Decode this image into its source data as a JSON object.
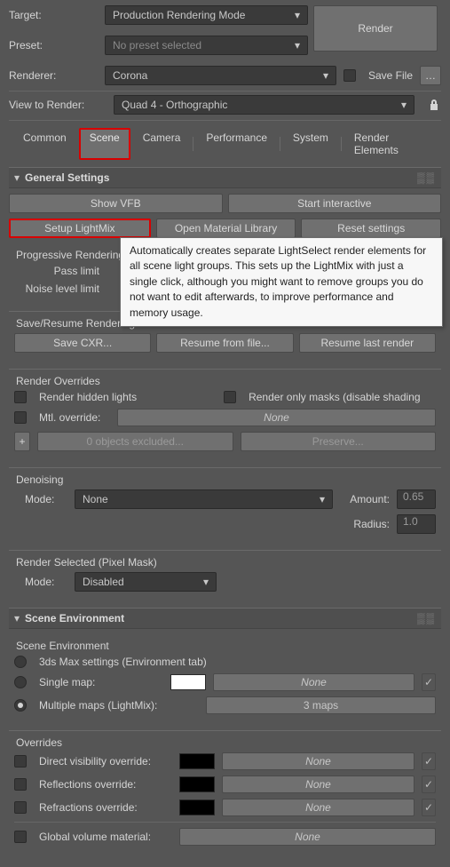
{
  "header": {
    "target_label": "Target:",
    "target_value": "Production Rendering Mode",
    "preset_label": "Preset:",
    "preset_value": "No preset selected",
    "renderer_label": "Renderer:",
    "renderer_value": "Corona",
    "save_file_label": "Save File",
    "view_label": "View to Render:",
    "view_value": "Quad 4 - Orthographic",
    "render_btn": "Render"
  },
  "tabs": [
    "Common",
    "Scene",
    "Camera",
    "Performance",
    "System",
    "Render Elements"
  ],
  "general": {
    "section_title": "General Settings",
    "show_vfb": "Show VFB",
    "start_interactive": "Start interactive",
    "setup_lightmix": "Setup LightMix",
    "open_material_library": "Open Material Library",
    "reset_settings": "Reset settings",
    "prog_title": "Progressive Rendering Limits",
    "pass_limit_label": "Pass limit",
    "noise_level_label": "Noise level limit",
    "save_resume_title": "Save/Resume Rendering",
    "save_cxr": "Save CXR...",
    "resume_from": "Resume from file...",
    "resume_last": "Resume last render",
    "render_overrides_title": "Render Overrides",
    "render_hidden": "Render hidden lights",
    "render_masks": "Render only masks (disable shading",
    "mtl_override": "Mtl. override:",
    "none": "None",
    "excluded": "0 objects excluded...",
    "preserve": "Preserve...",
    "denoising_title": "Denoising",
    "mode_label": "Mode:",
    "mode_value": "None",
    "amount_label": "Amount:",
    "amount_value": "0.65",
    "radius_label": "Radius:",
    "radius_value": "1.0",
    "render_selected_title": "Render Selected (Pixel Mask)",
    "render_selected_mode": "Disabled"
  },
  "environment": {
    "section_title": "Scene Environment",
    "scene_env_title": "Scene Environment",
    "max_settings": "3ds Max settings (Environment tab)",
    "single_map": "Single map:",
    "multiple_maps": "Multiple maps (LightMix):",
    "three_maps": "3 maps",
    "overrides_title": "Overrides",
    "direct_vis": "Direct visibility override:",
    "reflections": "Reflections override:",
    "refractions": "Refractions override:",
    "global_vol": "Global volume material:",
    "none": "None"
  },
  "tooltip": {
    "text": "Automatically creates separate LightSelect render elements for all scene light groups. This sets up the LightMix with just a single click, although you might want to remove groups you do not want to edit afterwards, to improve performance and memory usage."
  }
}
